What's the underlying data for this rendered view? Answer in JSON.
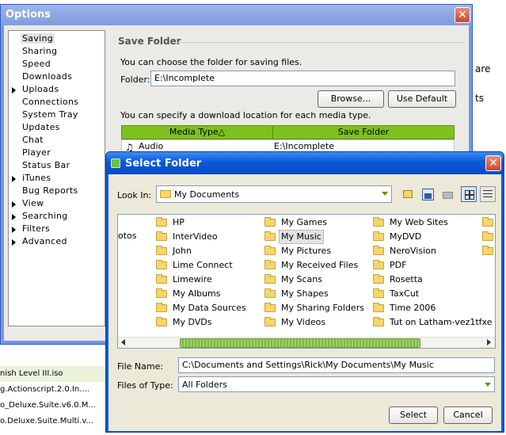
{
  "background": {
    "fragments": {
      "a": "are",
      "b": "ts"
    },
    "list_items": [
      "nish Level III.iso",
      "g.Actionscript.2.0.In....",
      "o_Deluxe.Suite.v6.0.M...",
      "o.Deluxe.Suite.Multi.v..."
    ]
  },
  "options": {
    "title": "Options",
    "nav": [
      {
        "label": "Saving",
        "expandable": false
      },
      {
        "label": "Sharing",
        "expandable": false
      },
      {
        "label": "Speed",
        "expandable": false
      },
      {
        "label": "Downloads",
        "expandable": false
      },
      {
        "label": "Uploads",
        "expandable": true
      },
      {
        "label": "Connections",
        "expandable": false
      },
      {
        "label": "System Tray",
        "expandable": false
      },
      {
        "label": "Updates",
        "expandable": false
      },
      {
        "label": "Chat",
        "expandable": false
      },
      {
        "label": "Player",
        "expandable": false
      },
      {
        "label": "Status Bar",
        "expandable": false
      },
      {
        "label": "iTunes",
        "expandable": true
      },
      {
        "label": "Bug Reports",
        "expandable": false
      },
      {
        "label": "View",
        "expandable": true
      },
      {
        "label": "Searching",
        "expandable": true
      },
      {
        "label": "Filters",
        "expandable": true
      },
      {
        "label": "Advanced",
        "expandable": true
      }
    ],
    "save_folder": {
      "legend": "Save Folder",
      "description": "You can choose the folder for saving files.",
      "folder_label": "Folder:",
      "folder_value": "E:\\Incomplete",
      "browse_label": "Browse...",
      "default_label": "Use Default",
      "media_description": "You can specify a download location for each media type.",
      "columns": [
        "Media Type",
        "Save Folder"
      ],
      "sort_indicator": "△",
      "rows": [
        {
          "type": "Audio",
          "folder": "E:\\Incomplete"
        }
      ]
    }
  },
  "select_folder": {
    "title": "Select Folder",
    "look_in_label": "Look In:",
    "look_in_value": "My Documents",
    "partial_left_item": "otos",
    "columns": [
      [
        "HP",
        "InterVideo",
        "John",
        "Lime Connect",
        "Limewire",
        "My Albums",
        "My Data Sources",
        "My DVDs"
      ],
      [
        "My Games",
        "My Music",
        "My Pictures",
        "My Received Files",
        "My Scans",
        "My Shapes",
        "My Sharing Folders",
        "My Videos"
      ],
      [
        "My Web Sites",
        "MyDVD",
        "NeroVision",
        "PDF",
        "Rosetta",
        "TaxCut",
        "Time 2006",
        "Tut on Latham-vez1tfxe"
      ]
    ],
    "selected_item": "My Music",
    "file_name_label": "File Name:",
    "file_name_value": "C:\\Documents and Settings\\Rick\\My Documents\\My Music",
    "files_of_type_label": "Files of Type:",
    "files_of_type_value": "All Folders",
    "select_label": "Select",
    "cancel_label": "Cancel"
  },
  "colors": {
    "accent_green": "#7ec11e",
    "title_blue": "#0a58d8",
    "options_blue": "#7a96df"
  }
}
